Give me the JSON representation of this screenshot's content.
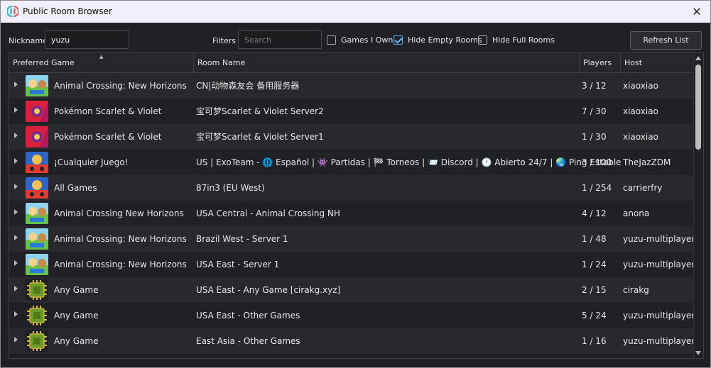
{
  "window": {
    "title": "Public Room Browser"
  },
  "toolbar": {
    "nickname_label": "Nickname",
    "nickname_value": "yuzu",
    "filters_label": "Filters",
    "search_placeholder": "Search",
    "games_i_own_label": "Games I Own",
    "games_i_own_checked": false,
    "hide_empty_label": "Hide Empty Rooms",
    "hide_empty_checked": true,
    "hide_full_label": "Hide Full Rooms",
    "hide_full_checked": false,
    "refresh_label": "Refresh List"
  },
  "table": {
    "columns": [
      "Preferred Game",
      "Room Name",
      "Players",
      "Host"
    ],
    "sort_column": "Preferred Game",
    "rows": [
      {
        "game": "Animal Crossing: New Horizons",
        "icon": "animal-crossing-thumb",
        "room": "CN|动物森友会 备用服务器",
        "players": "3 / 12",
        "host": "xiaoxiao"
      },
      {
        "game": "Pokémon Scarlet & Violet",
        "icon": "pokemon-sv-thumb",
        "room": "宝可梦Scarlet & Violet Server2",
        "players": "7 / 30",
        "host": "xiaoxiao"
      },
      {
        "game": "Pokémon Scarlet & Violet",
        "icon": "pokemon-sv-thumb",
        "room": "宝可梦Scarlet & Violet Server1",
        "players": "1 / 30",
        "host": "xiaoxiao"
      },
      {
        "game": "¡Cualquier Juego!",
        "icon": "mario-kart-thumb",
        "room": "US | ExoTeam - 🌐 Español | 👾 Partidas | 🏁 Torneos | 📨 Discord | 🕐 Abierto 24/7 | 🌏 Ping Estable",
        "players": "3 / 100",
        "host": "TheJazZDM"
      },
      {
        "game": "All Games",
        "icon": "mario-kart-thumb",
        "room": "87in3 (EU West)",
        "players": "1 / 254",
        "host": "carrierfry"
      },
      {
        "game": "Animal Crossing New Horizons",
        "icon": "animal-crossing-thumb",
        "room": "USA Central - Animal Crossing NH",
        "players": "4 / 12",
        "host": "anona"
      },
      {
        "game": "Animal Crossing: New Horizons",
        "icon": "animal-crossing-thumb",
        "room": "Brazil West - Server 1",
        "players": "1 / 48",
        "host": "yuzu-multiplayer"
      },
      {
        "game": "Animal Crossing: New Horizons",
        "icon": "animal-crossing-thumb",
        "room": "USA East - Server 1",
        "players": "1 / 24",
        "host": "yuzu-multiplayer"
      },
      {
        "game": "Any Game",
        "icon": "chip-icon",
        "room": "USA East - Any Game [cirakg.xyz]",
        "players": "2 / 15",
        "host": "cirakg"
      },
      {
        "game": "Any Game",
        "icon": "chip-icon",
        "room": "USA East - Other Games",
        "players": "5 / 24",
        "host": "yuzu-multiplayer"
      },
      {
        "game": "Any Game",
        "icon": "chip-icon",
        "room": "East Asia - Other Games",
        "players": "1 / 16",
        "host": "yuzu-multiplayer"
      }
    ]
  }
}
